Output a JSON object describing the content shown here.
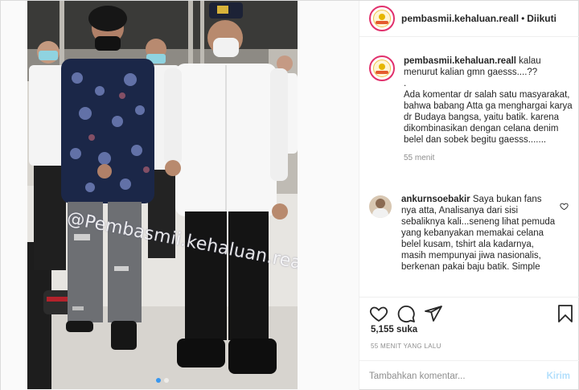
{
  "post": {
    "watermark": "@Pembasmii.kehaluan.reall",
    "carousel": {
      "count": 2,
      "active": 0
    }
  },
  "header": {
    "username": "pembasmii.kehaluan.reall",
    "separator": "•",
    "follow_label": "Diikuti"
  },
  "caption": {
    "username": "pembasmii.kehaluan.reall",
    "text_line1": " kalau menurut kalian gmn gaesss....??",
    "text_dot": ".",
    "text_body": "Ada komentar dr salah satu masyarakat, bahwa babang Atta ga menghargai karya dr Budaya bangsa, yaitu batik. karena dikombinasikan dengan celana denim belel dan sobek begitu gaesss.......",
    "time": "55 menit"
  },
  "comment": {
    "username": "ankurnsoebakir",
    "text": " Saya bukan fans nya atta, Analisanya dari sisi sebaliknya kali...seneng lihat pemuda yang kebanyakan memakai celana belel kusam, tshirt ala kadarnya, masih mempunyai jiwa nasionalis, berkenan pakai baju batik. Simple"
  },
  "actions": {
    "likes": "5,155 suka",
    "posted_ago": "55 MENIT YANG LALU",
    "icons": [
      "heart-icon",
      "comment-icon",
      "share-icon",
      "bookmark-icon"
    ]
  },
  "add_comment": {
    "placeholder": "Tambahkan komentar...",
    "post_label": "Kirim"
  },
  "colors": {
    "accent": "#3897f0",
    "post_disabled": "#b2dffc",
    "muted": "#8e8e8e",
    "story_ring": "#e1306c"
  }
}
